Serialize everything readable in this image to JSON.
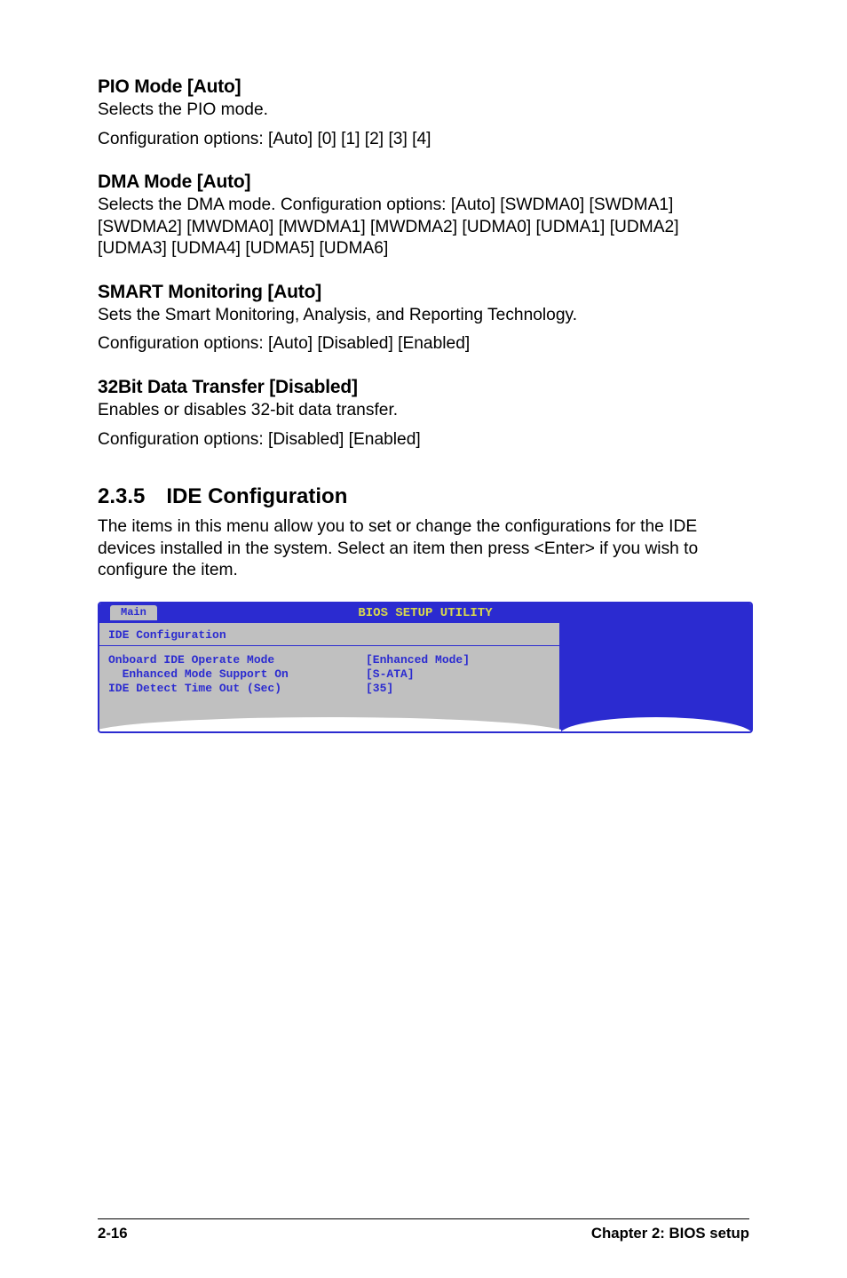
{
  "pio": {
    "heading": "PIO Mode [Auto]",
    "para1": "Selects the PIO mode.",
    "para2": "Configuration options: [Auto] [0] [1] [2] [3] [4]"
  },
  "dma": {
    "heading": "DMA Mode [Auto]",
    "para": "Selects the DMA mode. Configuration options: [Auto] [SWDMA0] [SWDMA1] [SWDMA2] [MWDMA0] [MWDMA1] [MWDMA2] [UDMA0] [UDMA1] [UDMA2] [UDMA3] [UDMA4] [UDMA5] [UDMA6]"
  },
  "smart": {
    "heading": "SMART Monitoring [Auto]",
    "para1": "Sets the Smart Monitoring, Analysis, and Reporting Technology.",
    "para2": "Configuration options: [Auto] [Disabled] [Enabled]"
  },
  "bit32": {
    "heading": "32Bit Data Transfer [Disabled]",
    "para1": "Enables or disables 32-bit data transfer.",
    "para2": "Configuration options: [Disabled] [Enabled]"
  },
  "section": {
    "num": "2.3.5",
    "title": "IDE Configuration",
    "intro": "The items in this menu allow you to set or change the configurations for the IDE devices installed in the system. Select an item then press <Enter> if you wish to configure the item."
  },
  "bios": {
    "title": "BIOS SETUP UTILITY",
    "tab": "Main",
    "blockTitle": "IDE Configuration",
    "rows": [
      {
        "label": "Onboard IDE Operate Mode",
        "value": "[Enhanced Mode]"
      },
      {
        "label": "  Enhanced Mode Support On",
        "value": "[S-ATA]"
      },
      {
        "label": "",
        "value": ""
      },
      {
        "label": "IDE Detect Time Out (Sec)",
        "value": "[35]"
      }
    ]
  },
  "footer": {
    "left": "2-16",
    "right": "Chapter 2: BIOS setup"
  }
}
